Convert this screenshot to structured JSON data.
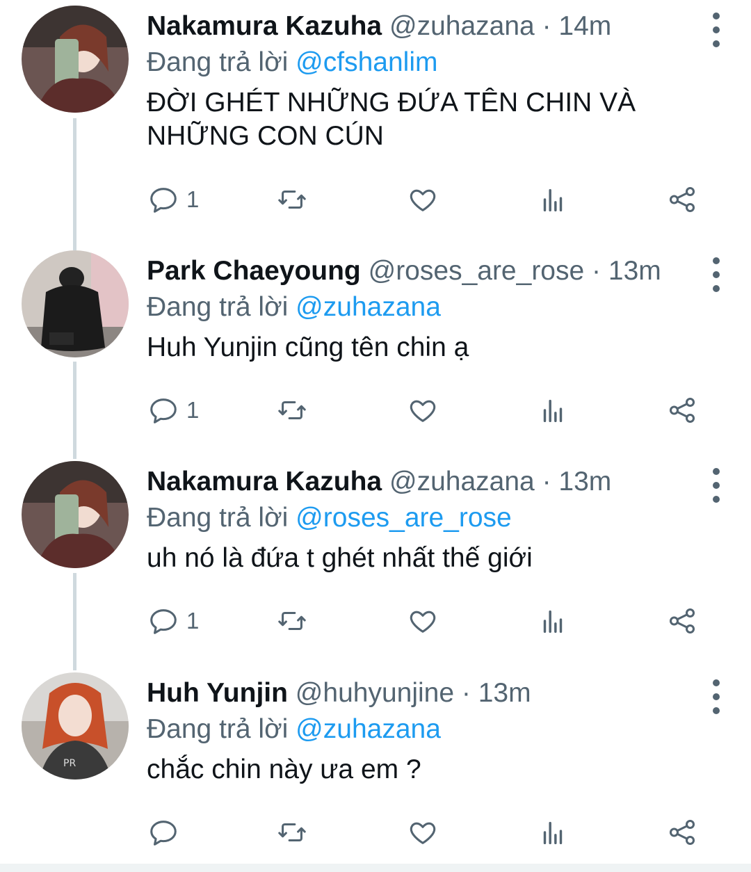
{
  "reply_prefix": "Đang trả lời",
  "tweets": [
    {
      "name": "Nakamura Kazuha",
      "handle": "@zuhazana",
      "sep": "·",
      "time": "14m",
      "reply_to": "@cfshanlim",
      "text": "ĐỜI GHÉT NHỮNG ĐỨA TÊN CHIN VÀ NHỮNG CON CÚN",
      "reply_count": "1"
    },
    {
      "name": "Park Chaeyoung",
      "handle": "@roses_are_rose",
      "sep": "·",
      "time": "13m",
      "reply_to": "@zuhazana",
      "text": "Huh Yunjin cũng tên chin ạ",
      "reply_count": "1"
    },
    {
      "name": "Nakamura Kazuha",
      "handle": "@zuhazana",
      "sep": "·",
      "time": "13m",
      "reply_to": "@roses_are_rose",
      "text": "uh nó là đứa t ghét nhất thế giới",
      "reply_count": "1"
    },
    {
      "name": "Huh Yunjin",
      "handle": "@huhyunjine",
      "sep": "·",
      "time": "13m",
      "reply_to": "@zuhazana",
      "text": "chắc chin này ưa em ?",
      "reply_count": ""
    }
  ],
  "icons": [
    "reply-icon",
    "retweet-icon",
    "like-icon",
    "analytics-icon",
    "share-icon",
    "more-icon"
  ],
  "colors": {
    "text": "#0f1419",
    "secondary": "#536471",
    "link": "#1d9bf0",
    "thread_line": "#cfd9de"
  }
}
